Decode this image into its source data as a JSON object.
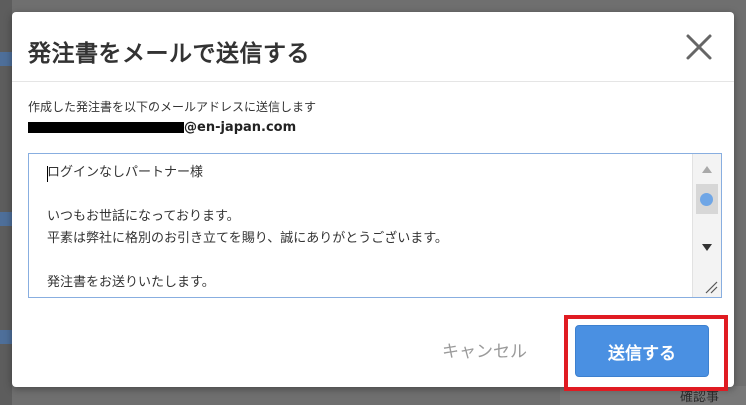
{
  "background": {
    "bottom_text": "確認事"
  },
  "dialog": {
    "title": "発注書をメールで送信する",
    "description": "作成した発注書を以下のメールアドレスに送信します",
    "email_domain": "@en-japan.com",
    "message_lines": [
      "ログインなしパートナー様",
      "",
      "いつもお世話になっております。",
      "平素は弊社に格別のお引き立てを賜り、誠にありがとうございます。",
      "",
      "発注書をお送りいたします。"
    ],
    "cancel_label": "キャンセル",
    "send_label": "送信する"
  },
  "colors": {
    "accent": "#4a90e2",
    "highlight": "#e01b22",
    "overlay": "#6f6f6f"
  }
}
